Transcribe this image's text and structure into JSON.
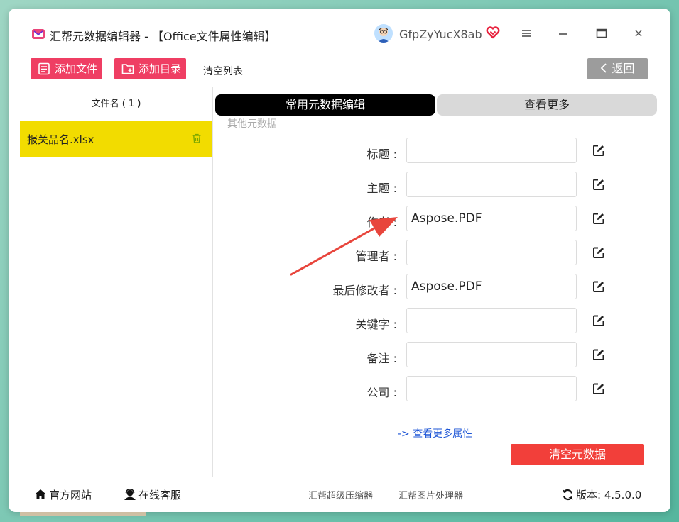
{
  "window": {
    "title": "汇帮元数据编辑器 - 【Office文件属性编辑】",
    "username": "GfpZyYucX8ab"
  },
  "toolbar": {
    "add_file_label": "添加文件",
    "add_dir_label": "添加目录",
    "clear_list_label": "清空列表",
    "back_label": "返回"
  },
  "file_list": {
    "header": "文件名 ( 1 )",
    "files": [
      {
        "name": "报关品名.xlsx"
      }
    ]
  },
  "tabs": [
    {
      "label": "常用元数据编辑",
      "active": true
    },
    {
      "label": "查看更多",
      "active": false
    }
  ],
  "section_label": "其他元数据",
  "fields": [
    {
      "label": "标题 :",
      "value": ""
    },
    {
      "label": "主题 :",
      "value": ""
    },
    {
      "label": "作者 :",
      "value": "Aspose.PDF"
    },
    {
      "label": "管理者 :",
      "value": ""
    },
    {
      "label": "最后修改者 :",
      "value": "Aspose.PDF"
    },
    {
      "label": "关键字 :",
      "value": ""
    },
    {
      "label": "备注 :",
      "value": ""
    },
    {
      "label": "公司 :",
      "value": ""
    }
  ],
  "more_link": "-> 查看更多属性",
  "clear_meta_label": "清空元数据",
  "footer": {
    "website": "官方网站",
    "service": "在线客服",
    "compressor": "汇帮超级压缩器",
    "image_tool": "汇帮图片处理器",
    "version": "版本: 4.5.0.0"
  },
  "colors": {
    "accent_pink": "#ef3e63",
    "selected_row": "#f2dc00",
    "clear_button": "#f23f3a",
    "annotation_arrow": "#e8453c"
  }
}
